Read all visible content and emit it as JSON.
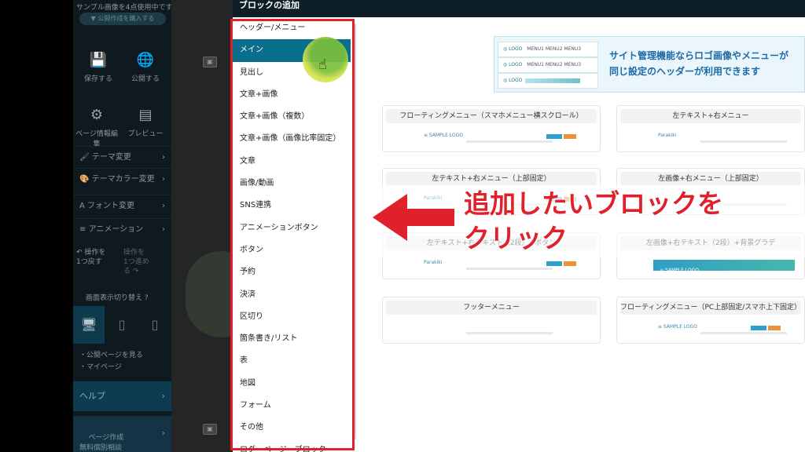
{
  "sidebar": {
    "top_notice": "サンプル画像を4点使用中です",
    "top_button": "▼ 公開作成を購入する",
    "save_label": "保存する",
    "publish_label": "公開する",
    "page_info_label": "ページ情報編集",
    "preview_label": "プレビュー",
    "menu": [
      {
        "label": "テーマ変更"
      },
      {
        "label": "テーマカラー変更"
      },
      {
        "label": "フォント変更"
      },
      {
        "label": "アニメーション"
      }
    ],
    "undo_label": "操作を\n1つ戻す",
    "redo_label": "操作を\n1つ進め\nる",
    "display_switch_label": "画面表示切り替え",
    "links": [
      "・公開ページを見る",
      "・マイページ"
    ],
    "help_label": "ヘルプ",
    "consult_label": "ページ作成\n無料個別相談"
  },
  "modal": {
    "title": "ブロックの追加",
    "block_categories": [
      {
        "label": "ヘッダー/メニュー"
      },
      {
        "label": "メイン"
      },
      {
        "label": "見出し"
      },
      {
        "label": "文章+画像"
      },
      {
        "label": "文章+画像（複数）"
      },
      {
        "label": "文章+画像（画像比率固定）"
      },
      {
        "label": "文章"
      },
      {
        "label": "画像/動画"
      },
      {
        "label": "SNS連携"
      },
      {
        "label": "アニメーションボタン"
      },
      {
        "label": "ボタン"
      },
      {
        "label": "予約"
      },
      {
        "label": "決済"
      },
      {
        "label": "区切り"
      },
      {
        "label": "箇条書き/リスト"
      },
      {
        "label": "表"
      },
      {
        "label": "地図"
      },
      {
        "label": "フォーム"
      },
      {
        "label": "その他"
      },
      {
        "label": "ログ・ページ・ブロック"
      }
    ],
    "selected_category": "メイン",
    "banner_text_line1": "サイト管理機能ならロゴ画像やメニューが",
    "banner_text_line2": "同じ設定のヘッダーが利用できます",
    "templates": [
      {
        "title": "フローティングメニュー（スマホメニュー横スクロール）",
        "logo": "≡ SAMPLE LOGO"
      },
      {
        "title": "左テキスト+右メニュー",
        "logo": "Parakiki"
      },
      {
        "title": "左テキスト+右メニュー（上部固定）",
        "logo": "Parakiki"
      },
      {
        "title": "左画像+右メニュー（上部固定）",
        "logo": ""
      },
      {
        "title": "左テキスト+右テキスト（2段）+ボタン",
        "logo": "Parakiki"
      },
      {
        "title": "左画像+右テキスト（2段）+背景グラデ",
        "logo": "≡ SAMPLE LOGO"
      },
      {
        "title": "フッターメニュー",
        "logo": ""
      },
      {
        "title": "フローティングメニュー（PC上部固定/スマホ上下固定）",
        "logo": "≡ SAMPLE LOGO"
      }
    ]
  },
  "annotation": {
    "line1": "追加したいブロックを",
    "line2": "クリック",
    "color": "#e0202a"
  }
}
